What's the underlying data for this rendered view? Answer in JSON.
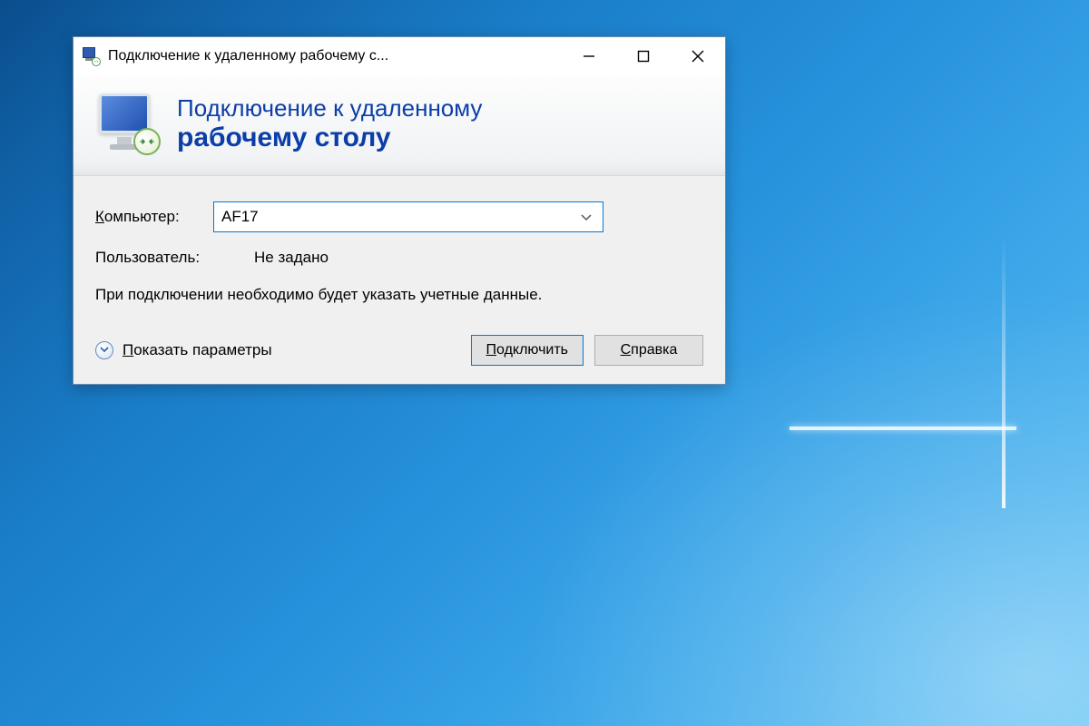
{
  "window": {
    "title": "Подключение к удаленному рабочему с..."
  },
  "banner": {
    "line1": "Подключение к удаленному",
    "line2": "рабочему столу"
  },
  "form": {
    "computer_label_prefix": "К",
    "computer_label_rest": "омпьютер:",
    "computer_value": "AF17",
    "user_label": "Пользователь:",
    "user_value": "Не задано",
    "hint": "При подключении необходимо будет указать учетные данные."
  },
  "footer": {
    "show_params_prefix": "П",
    "show_params_rest": "оказать параметры",
    "connect_prefix": "П",
    "connect_rest": "одключить",
    "help_prefix": "С",
    "help_rest": "правка"
  }
}
